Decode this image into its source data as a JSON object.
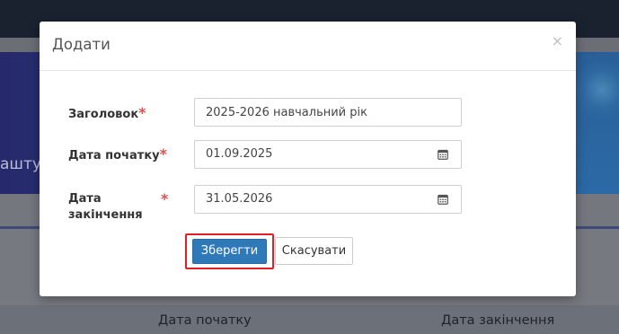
{
  "background": {
    "hero_text": "аштув",
    "table_headers": [
      "Дата початку",
      "Дата закінчення"
    ]
  },
  "modal": {
    "title": "Додати",
    "close_icon": "×",
    "required_mark": "*",
    "fields": [
      {
        "label": "Заголовок",
        "value": "2025-2026 навчальний рік",
        "icon": ""
      },
      {
        "label": "Дата початку",
        "value": "01.09.2025",
        "icon": "calendar-icon"
      },
      {
        "label_line1": "Дата",
        "label_line2": "закінчення",
        "value": "31.05.2026",
        "icon": "calendar-icon"
      }
    ],
    "save_label": "Зберегти",
    "cancel_label": "Скасувати"
  },
  "colors": {
    "primary_button": "#2f79b9",
    "required": "#d9534f",
    "highlight_box": "#e11f26"
  }
}
